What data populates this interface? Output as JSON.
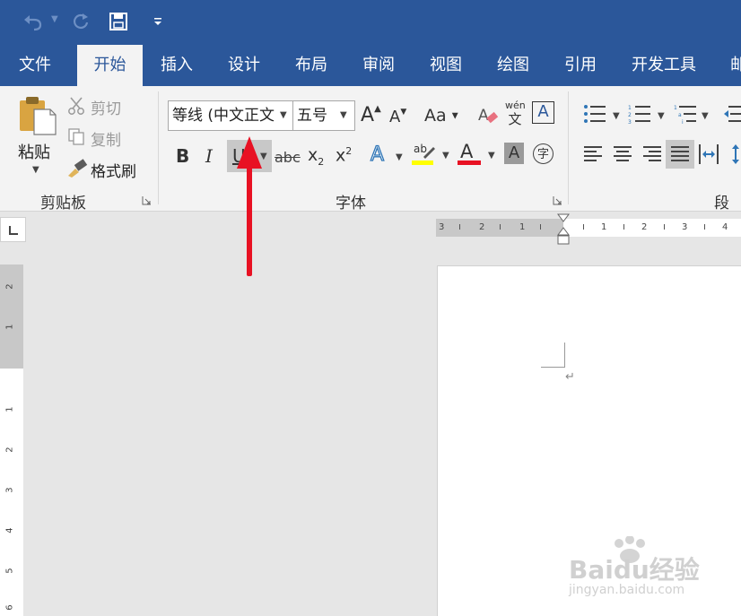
{
  "qat": {
    "undo_icon": "undo-icon",
    "redo_icon": "redo-icon",
    "save_icon": "save-icon",
    "customize_icon": "customize-qat-icon"
  },
  "tabs": [
    "文件",
    "开始",
    "插入",
    "设计",
    "布局",
    "审阅",
    "视图",
    "绘图",
    "引用",
    "开发工具",
    "邮"
  ],
  "active_tab": "开始",
  "clipboard": {
    "paste": "粘贴",
    "cut": "剪切",
    "copy": "复制",
    "format_painter": "格式刷",
    "group_label": "剪贴板"
  },
  "font": {
    "font_name": "等线 (中文正文",
    "font_size": "五号",
    "group_label": "字体",
    "bold": "B",
    "italic": "I",
    "underline": "U",
    "strikethrough": "abc",
    "subscript": "x",
    "subscript_mark": "2",
    "superscript": "x",
    "superscript_mark": "2",
    "case": "Aa",
    "grow": "A",
    "shrink": "A",
    "phonetic_top": "wén",
    "phonetic_bottom": "文",
    "border_char": "A",
    "effects": "A",
    "highlight": "ab",
    "font_color": "A",
    "shading": "A",
    "enclose": "字"
  },
  "paragraph": {
    "group_label": "段落"
  },
  "ruler_h": [
    "3",
    "2",
    "1",
    "1",
    "2",
    "3",
    "4"
  ],
  "ruler_v": [
    "2",
    "1",
    "1",
    "2",
    "3",
    "4",
    "5",
    "6"
  ],
  "colors": {
    "accent": "#2b579a",
    "highlight_bar": "#ffff00",
    "font_color_bar": "#e81123",
    "arrow": "#e81123"
  },
  "watermark": {
    "brand": "Baidu经验",
    "url": "jingyan.baidu.com"
  }
}
